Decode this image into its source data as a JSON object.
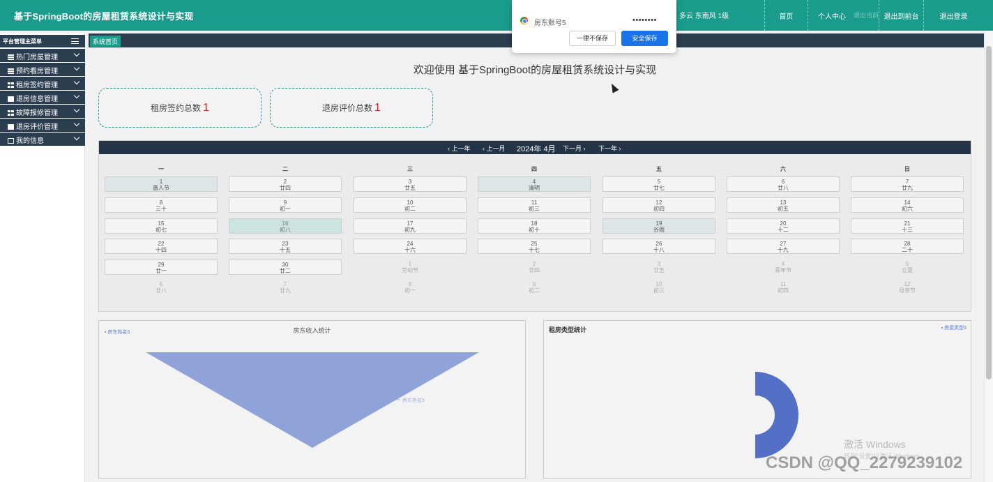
{
  "header": {
    "title": "基于SpringBoot的房屋租赁系统设计与实现",
    "weather": "多云  东南风  1级",
    "weather_faint": "退出当前",
    "nav": [
      "首页",
      "个人中心",
      "退出到前台",
      "退出登录"
    ]
  },
  "sidebar": {
    "heading": "平台管理主菜单",
    "items": [
      {
        "label": "热门房屋管理",
        "icon": "list-icon"
      },
      {
        "label": "预约看房管理",
        "icon": "list-icon"
      },
      {
        "label": "租房签约管理",
        "icon": "table-icon"
      },
      {
        "label": "退房信息管理",
        "icon": "folder-icon"
      },
      {
        "label": "故障报修管理",
        "icon": "grid-icon"
      },
      {
        "label": "退房评价管理",
        "icon": "box-icon"
      },
      {
        "label": "我的信息",
        "icon": "frame-icon"
      }
    ]
  },
  "tabs": {
    "home": "系统首页"
  },
  "welcome": "欢迎使用 基于SpringBoot的房屋租赁系统设计与实现",
  "stats": [
    {
      "label": "租房签约总数",
      "value": "1"
    },
    {
      "label": "退房评价总数",
      "value": "1"
    }
  ],
  "calendar": {
    "prev_year": "上一年",
    "prev_month": "上一月",
    "month": "2024年 4月",
    "next_month": "下一月",
    "next_year": "下一年",
    "weekdays": [
      "一",
      "二",
      "三",
      "四",
      "五",
      "六",
      "日"
    ],
    "weeks": [
      [
        {
          "d": "1",
          "l": "愚人节",
          "s": "hl"
        },
        {
          "d": "2",
          "l": "廿四"
        },
        {
          "d": "3",
          "l": "廿五"
        },
        {
          "d": "4",
          "l": "清明",
          "s": "hl"
        },
        {
          "d": "5",
          "l": "廿七"
        },
        {
          "d": "6",
          "l": "廿八"
        },
        {
          "d": "7",
          "l": "廿九"
        }
      ],
      [
        {
          "d": "8",
          "l": "三十"
        },
        {
          "d": "9",
          "l": "初一"
        },
        {
          "d": "10",
          "l": "初二"
        },
        {
          "d": "11",
          "l": "初三"
        },
        {
          "d": "12",
          "l": "初四"
        },
        {
          "d": "13",
          "l": "初五"
        },
        {
          "d": "14",
          "l": "初六"
        }
      ],
      [
        {
          "d": "15",
          "l": "初七"
        },
        {
          "d": "16",
          "l": "初八",
          "s": "today"
        },
        {
          "d": "17",
          "l": "初九"
        },
        {
          "d": "18",
          "l": "初十"
        },
        {
          "d": "19",
          "l": "谷雨",
          "s": "hl"
        },
        {
          "d": "20",
          "l": "十二"
        },
        {
          "d": "21",
          "l": "十三"
        }
      ],
      [
        {
          "d": "22",
          "l": "十四"
        },
        {
          "d": "23",
          "l": "十五"
        },
        {
          "d": "24",
          "l": "十六"
        },
        {
          "d": "25",
          "l": "十七"
        },
        {
          "d": "26",
          "l": "十八"
        },
        {
          "d": "27",
          "l": "十九"
        },
        {
          "d": "28",
          "l": "二十"
        }
      ],
      [
        {
          "d": "29",
          "l": "廿一"
        },
        {
          "d": "30",
          "l": "廿二"
        },
        {
          "d": "1",
          "l": "劳动节",
          "s": "other"
        },
        {
          "d": "2",
          "l": "廿四",
          "s": "other"
        },
        {
          "d": "3",
          "l": "廿五",
          "s": "other"
        },
        {
          "d": "4",
          "l": "青年节",
          "s": "other"
        },
        {
          "d": "5",
          "l": "立夏",
          "s": "other"
        }
      ],
      [
        {
          "d": "6",
          "l": "廿八",
          "s": "other"
        },
        {
          "d": "7",
          "l": "廿九",
          "s": "other"
        },
        {
          "d": "8",
          "l": "初一",
          "s": "other"
        },
        {
          "d": "9",
          "l": "初二",
          "s": "other"
        },
        {
          "d": "10",
          "l": "初三",
          "s": "other"
        },
        {
          "d": "11",
          "l": "初四",
          "s": "other"
        },
        {
          "d": "12",
          "l": "母亲节",
          "s": "other"
        }
      ]
    ]
  },
  "chart_data": [
    {
      "type": "funnel",
      "title": "房东收入统计",
      "legend": [
        "房东姓名5"
      ],
      "legend_position": "top-left",
      "categories": [
        "房东姓名5"
      ],
      "values": [
        100
      ],
      "color": "#8fa3d8"
    },
    {
      "type": "pie",
      "title": "租房类型统计",
      "legend": [
        "房屋类型5"
      ],
      "legend_position": "top-right",
      "categories": [
        "房屋类型5"
      ],
      "values": [
        100
      ],
      "color": "#5470c6"
    }
  ],
  "popup": {
    "account": "房东账号5",
    "password": "••••••••",
    "never_label": "一律不保存",
    "save_label": "安全保存"
  },
  "watermarks": {
    "windows_title": "激活 Windows",
    "windows_sub": "转到\"设置\"以激活 Windows。",
    "csdn": "CSDN @QQ_2279239102"
  }
}
